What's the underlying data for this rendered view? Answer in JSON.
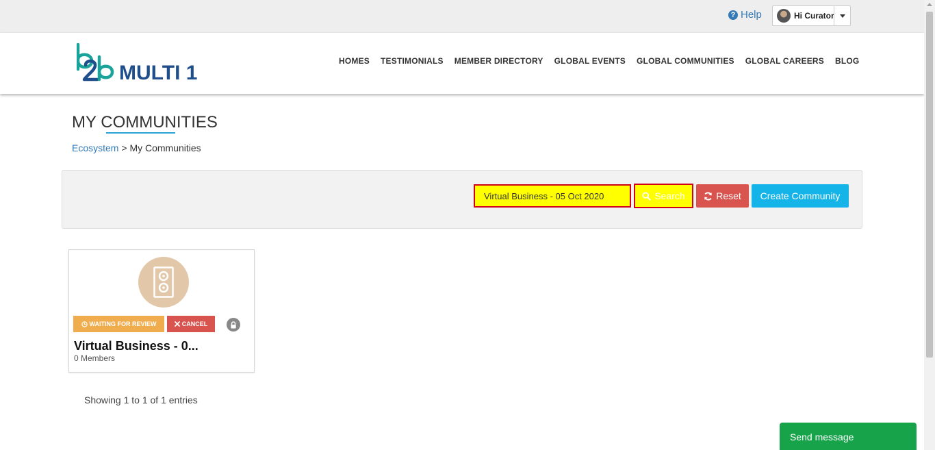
{
  "header": {
    "help_label": "Help",
    "help_icon": "question-circle-icon",
    "user_greeting": "Hi Curator"
  },
  "brand": {
    "logo_mark": "b2b",
    "logo_text": "MULTI 1",
    "colors": {
      "teal": "#1aa39a",
      "navy": "#1f4e8c"
    }
  },
  "nav": {
    "items": [
      {
        "label": "HOMES"
      },
      {
        "label": "TESTIMONIALS"
      },
      {
        "label": "MEMBER DIRECTORY"
      },
      {
        "label": "GLOBAL EVENTS"
      },
      {
        "label": "GLOBAL COMMUNITIES"
      },
      {
        "label": "GLOBAL CAREERS"
      },
      {
        "label": "BLOG"
      }
    ]
  },
  "page": {
    "title": "MY COMMUNITIES",
    "breadcrumb": {
      "link": "Ecosystem",
      "separator": ">",
      "current": "My Communities"
    }
  },
  "filters": {
    "search_value": "Virtual Business - 05 Oct 2020",
    "search_label": "Search",
    "reset_label": "Reset",
    "create_label": "Create Community",
    "colors": {
      "highlight": "#ffff00",
      "outline": "#d0021b",
      "reset": "#d9534f",
      "create": "#14b4e8"
    }
  },
  "communities": [
    {
      "name": "Virtual Business - 0...",
      "members": "0 Members",
      "status_badge": "WAITING FOR REVIEW",
      "cancel_badge": "CANCEL",
      "privacy_icon": "lock-icon",
      "icon_color": "#e2c8a8"
    }
  ],
  "pagination": {
    "summary": "Showing 1 to 1 of 1 entries"
  },
  "chat": {
    "label": "Send message",
    "color": "#17a34a"
  }
}
